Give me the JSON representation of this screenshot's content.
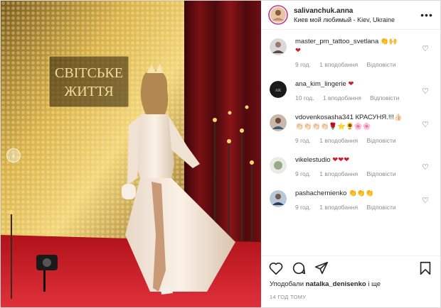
{
  "header": {
    "username": "salivanchuk.anna",
    "location": "Киев мой любимый - Kiev, Ukraine"
  },
  "media": {
    "sign_line1": "СВІТСЬКЕ",
    "sign_line2": "ЖИТТЯ"
  },
  "comments": [
    {
      "username": "master_pm_tattoo_svetlana",
      "text_line1": "👏🙌",
      "text_line2": "❤",
      "time": "9 год.",
      "likes": "1 вподобання",
      "reply": "Відповісти"
    },
    {
      "username": "ana_kim_lingerie",
      "text_line1": "❤",
      "text_line2": "",
      "time": "10 год.",
      "likes": "1 вподобання",
      "reply": "Відповісти"
    },
    {
      "username": "vdovenkosasha341",
      "text_line1": "КРАСУНЯ.!!!👍🏻",
      "text_line2": "👏🏻👏🏻👏🏻👏🏻🌹⭐🌻🌸🌸",
      "time": "9 год.",
      "likes": "1 вподобання",
      "reply": "Відповісти"
    },
    {
      "username": "vikelestudio",
      "text_line1": "❤❤❤",
      "text_line2": "",
      "time": "9 год.",
      "likes": "1 вподобання",
      "reply": "Відповісти"
    },
    {
      "username": "pashachernienko",
      "text_line1": "👏👏👏",
      "text_line2": "",
      "time": "9 год.",
      "likes": "1 вподобання",
      "reply": "Відповісти"
    }
  ],
  "liked_by": {
    "prefix": "Уподобали",
    "user": "natalka_denisenko",
    "suffix": "і ще"
  },
  "timestamp": "14 ГОД ТОМУ",
  "icons": [
    "heart-icon",
    "comment-icon",
    "share-icon",
    "bookmark-icon",
    "more-icon",
    "chevron-left-icon"
  ]
}
